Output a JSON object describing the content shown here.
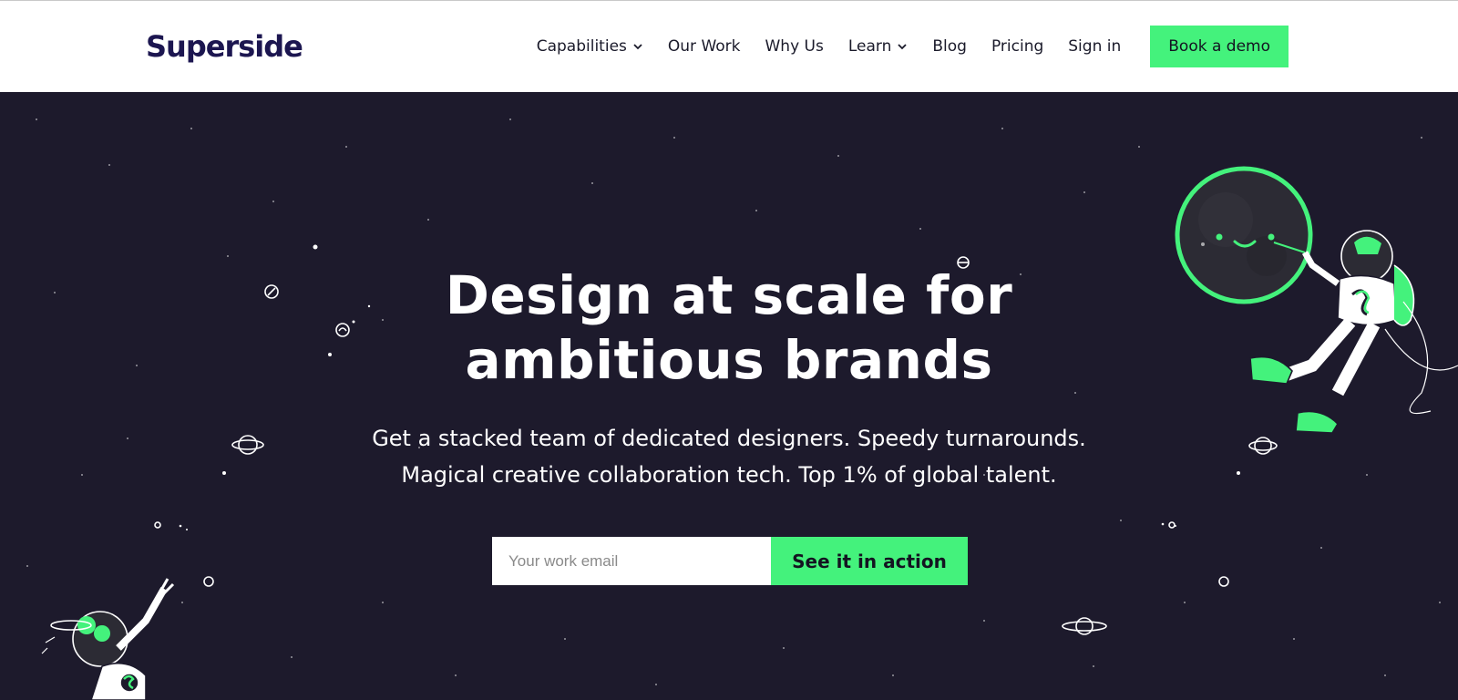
{
  "brand": {
    "name": "Superside",
    "color": "#1c1650"
  },
  "nav": {
    "items": [
      {
        "label": "Capabilities",
        "dropdown": true
      },
      {
        "label": "Our Work",
        "dropdown": false
      },
      {
        "label": "Why Us",
        "dropdown": false
      },
      {
        "label": "Learn",
        "dropdown": true
      },
      {
        "label": "Blog",
        "dropdown": false
      },
      {
        "label": "Pricing",
        "dropdown": false
      },
      {
        "label": "Sign in",
        "dropdown": false
      }
    ],
    "cta_label": "Book a demo"
  },
  "hero": {
    "headline_line1": "Design at scale for",
    "headline_line2": "ambitious brands",
    "sub_line1": "Get a stacked team of dedicated designers. Speedy turnarounds.",
    "sub_line2": "Magical creative collaboration tech. Top 1% of global talent.",
    "email_placeholder": "Your work email",
    "email_value": "",
    "cta_label": "See it in action"
  },
  "colors": {
    "accent": "#44f27c",
    "hero_background": "#1d1a2c",
    "text_dark": "#141421"
  },
  "icons": [
    "chevron-down-icon",
    "planet-icon",
    "astronaut-illustration",
    "moon-illustration"
  ]
}
